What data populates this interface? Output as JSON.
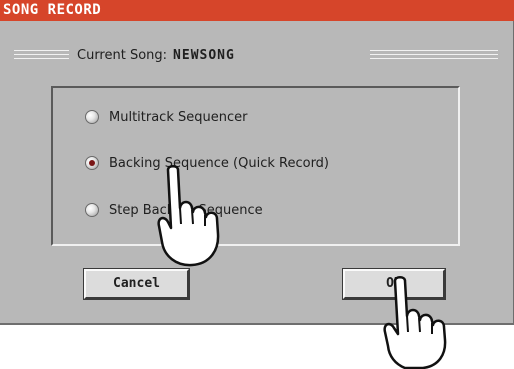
{
  "dialog": {
    "title": "SONG RECORD",
    "current_song_label": "Current Song:",
    "current_song_name": "NEWSONG"
  },
  "options": [
    {
      "label": "Multitrack Sequencer",
      "selected": false
    },
    {
      "label": "Backing Sequence (Quick Record)",
      "selected": true
    },
    {
      "label": "Step Backing Sequence",
      "selected": false
    }
  ],
  "buttons": {
    "cancel": "Cancel",
    "ok": "OK"
  },
  "colors": {
    "title_bar": "#d6452a",
    "dialog_background": "#b8b8b8",
    "radio_selected": "#7a1616"
  },
  "icons": [
    "pointing-hand-icon"
  ]
}
